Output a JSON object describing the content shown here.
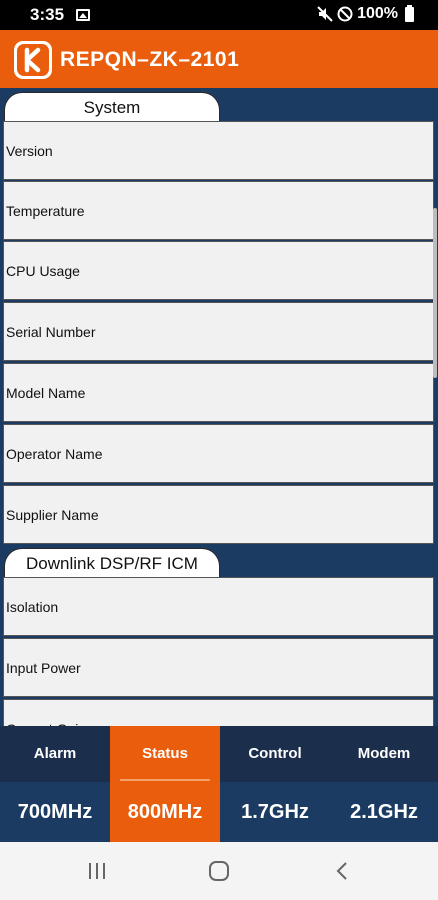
{
  "status_bar": {
    "time": "3:35",
    "battery": "100%",
    "icons": [
      "gallery-icon",
      "mute-icon",
      "do-not-disturb-icon",
      "battery-icon"
    ]
  },
  "app_bar": {
    "logo": "K",
    "title": "REPQN–ZK–2101",
    "brand_color": "#ea5d0c"
  },
  "sections": [
    {
      "title": "System",
      "rows": [
        "Version",
        "Temperature",
        "CPU Usage",
        "Serial Number",
        "Model Name",
        "Operator Name",
        "Supplier Name"
      ]
    },
    {
      "title": "Downlink DSP/RF ICM",
      "rows": [
        "Isolation",
        "Input Power",
        "Current Gain"
      ]
    }
  ],
  "tabs": {
    "top": [
      "Alarm",
      "Status",
      "Control",
      "Modem"
    ],
    "bottom": [
      "700MHz",
      "800MHz",
      "1.7GHz",
      "2.1GHz"
    ],
    "active_top": "Status",
    "active_bottom": "800MHz"
  },
  "nav_bar": {
    "buttons": [
      "recent-apps-icon",
      "home-icon",
      "back-icon"
    ]
  },
  "colors": {
    "accent": "#ea5d0c",
    "panel": "#1b3b63",
    "tab_bar": "#1b2f4d"
  }
}
